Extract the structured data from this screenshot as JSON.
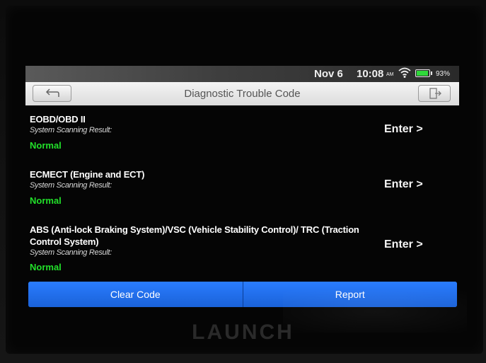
{
  "status_bar": {
    "date": "Nov 6",
    "time": "10:08",
    "ampm": "AM",
    "wifi_icon": "wifi-icon",
    "battery_icon": "battery-icon",
    "battery_level": 0.93,
    "battery_percent": "93%"
  },
  "header": {
    "title": "Diagnostic Trouble Code",
    "back_icon": "back-arrow-icon",
    "exit_icon": "exit-icon"
  },
  "systems": [
    {
      "name": "EOBD/OBD II",
      "subtitle": "System Scanning Result:",
      "status": "Normal",
      "enter_label": "Enter >"
    },
    {
      "name": "ECMECT (Engine and ECT)",
      "subtitle": "System Scanning Result:",
      "status": "Normal",
      "enter_label": "Enter >"
    },
    {
      "name": "ABS (Anti-lock Braking System)/VSC (Vehicle Stability Control)/ TRC (Traction Control System)",
      "subtitle": "System Scanning Result:",
      "status": "Normal",
      "enter_label": "Enter >"
    }
  ],
  "footer": {
    "clear_code_label": "Clear Code",
    "report_label": "Report"
  },
  "device": {
    "brand": "LAUNCH"
  },
  "colors": {
    "status_normal": "#22e02a",
    "button_blue": "#2a7cff",
    "title_bar": "#e8e8e8"
  }
}
